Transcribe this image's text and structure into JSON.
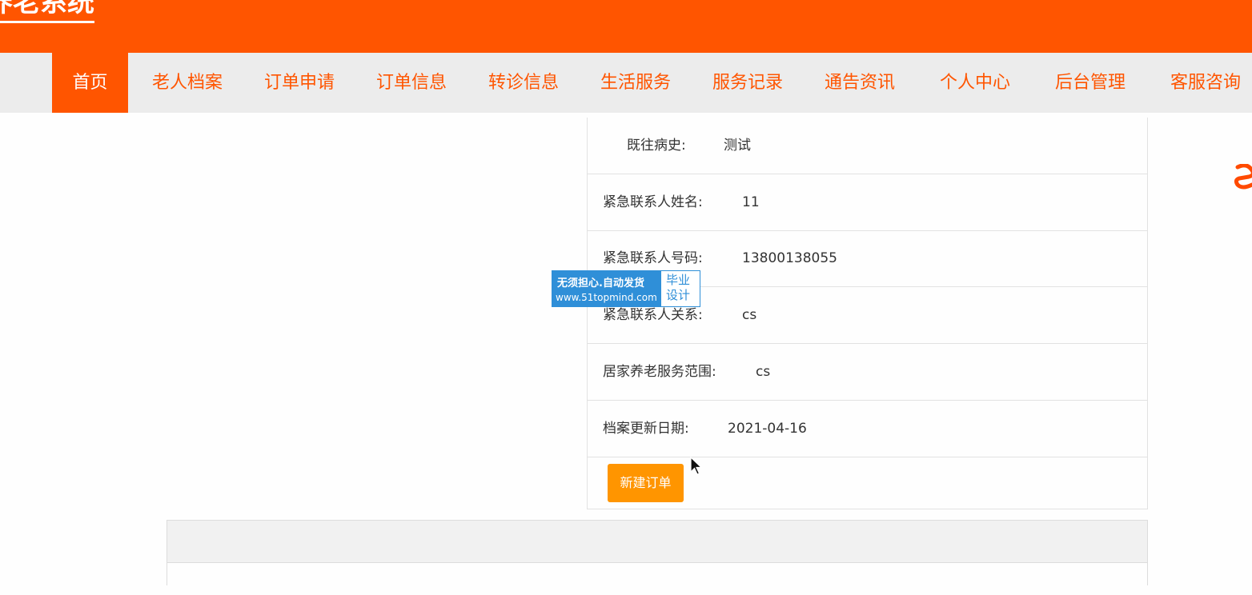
{
  "header": {
    "title": "养老系统"
  },
  "nav": {
    "items": [
      {
        "label": "首页",
        "active": true
      },
      {
        "label": "老人档案"
      },
      {
        "label": "订单申请"
      },
      {
        "label": "订单信息"
      },
      {
        "label": "转诊信息"
      },
      {
        "label": "生活服务"
      },
      {
        "label": "服务记录"
      },
      {
        "label": "通告资讯"
      },
      {
        "label": "个人中心"
      },
      {
        "label": "后台管理"
      },
      {
        "label": "客服咨询"
      }
    ]
  },
  "profile": {
    "rows": [
      {
        "label": "既往病史:",
        "value": "测试"
      },
      {
        "label": "紧急联系人姓名:",
        "value": "11"
      },
      {
        "label": "紧急联系人号码:",
        "value": "13800138055"
      },
      {
        "label": "紧急联系人关系:",
        "value": "cs"
      },
      {
        "label": "居家养老服务范围:",
        "value": "cs"
      },
      {
        "label": "档案更新日期:",
        "value": "2021-04-16"
      }
    ],
    "new_order_label": "新建订单"
  },
  "watermark": {
    "line1": "无须担心.自动发货",
    "line2": "www.51topmind.com",
    "right": "毕业设计"
  },
  "colors": {
    "brand": "#ff5500",
    "button": "#ff9500",
    "watermark": "#2f8fd8"
  }
}
